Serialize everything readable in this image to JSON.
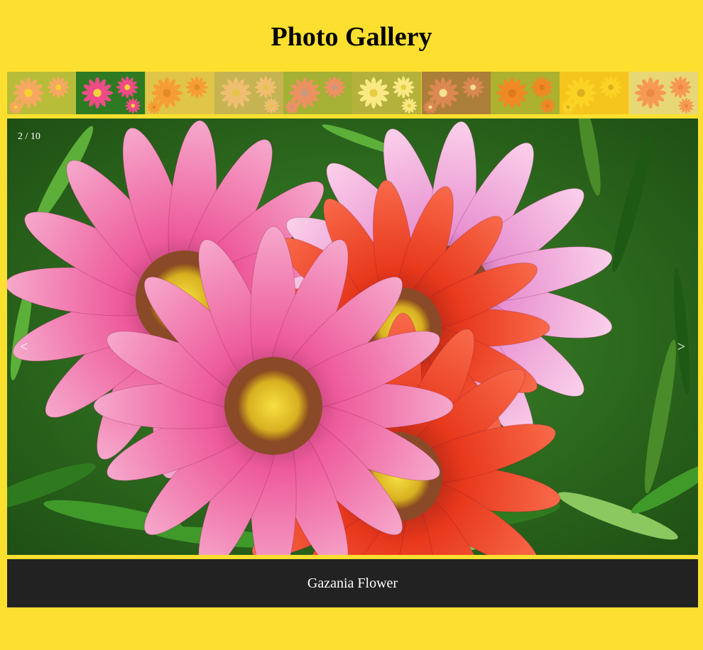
{
  "page": {
    "title": "Photo Gallery"
  },
  "gallery": {
    "counter": "2 / 10",
    "caption": "Gazania Flower",
    "prev_label": "<",
    "next_label": ">",
    "active_index": 1,
    "thumbnails": [
      {
        "icon": "pink-flower-thumbnail-icon",
        "petal": "#f07a8a",
        "center": "#f2c531",
        "bg": "#7fa043"
      },
      {
        "icon": "gazania-flower-thumbnail-icon",
        "petal": "#ee4c86",
        "center": "#f4d23a",
        "bg": "#2e7a22"
      },
      {
        "icon": "orange-flower-thumbnail-icon",
        "petal": "#f0663a",
        "center": "#c94620",
        "bg": "#c8b060"
      },
      {
        "icon": "lotus-flower-thumbnail-icon",
        "petal": "#e6a2a8",
        "center": "#d2b060",
        "bg": "#9a9070"
      },
      {
        "icon": "pink-flowers-thumbnail-icon",
        "petal": "#e0508e",
        "center": "#a060c0",
        "bg": "#5c8a3a"
      },
      {
        "icon": "white-flowers-thumbnail-icon",
        "petal": "#f8f0c8",
        "center": "#d8c050",
        "bg": "#7a8a4a"
      },
      {
        "icon": "striped-flowers-thumbnail-icon",
        "petal": "#c04070",
        "center": "#f0e0e0",
        "bg": "#6a3040"
      },
      {
        "icon": "rose-flower-thumbnail-icon",
        "petal": "#e8401c",
        "center": "#c02a10",
        "bg": "#6a8a30"
      },
      {
        "icon": "yellow-flower-thumbnail-icon",
        "petal": "#f8c81c",
        "center": "#c08a10",
        "bg": "#f0b010"
      },
      {
        "icon": "tulip-flower-thumbnail-icon",
        "petal": "#f06070",
        "center": "#e04050",
        "bg": "#d8d0b0"
      }
    ],
    "colors": {
      "background": "#fde02f",
      "caption_bg": "#222222",
      "caption_text": "#ffffff"
    }
  }
}
